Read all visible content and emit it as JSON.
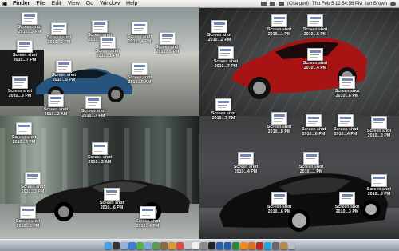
{
  "menubar": {
    "apple": "",
    "app_name": "Finder",
    "menus": [
      "File",
      "Edit",
      "View",
      "Go",
      "Window",
      "Help"
    ],
    "status": {
      "battery": "(Charged)",
      "datetime": "Thu Feb 5  12:54:56 PM",
      "user": "Ian Brown"
    }
  },
  "desktop": {
    "icons": [
      {
        "label": "Screen shot\n2010...3 PM"
      },
      {
        "label": "Screen shot\n2010...2 PM"
      },
      {
        "label": "Screen shot\n2010...9 PM"
      },
      {
        "label": "Screen shot\n2010...4 PM"
      },
      {
        "label": "Screen shot\n2010...6 PM"
      },
      {
        "label": "Screen shot\n2010...7 PM"
      },
      {
        "label": "Screen shot\n2010...1 PM"
      },
      {
        "label": "Screen shot\n2010...5 PM"
      },
      {
        "label": "Screen shot\n2010...9 AM"
      },
      {
        "label": "Screen shot\n2010...3 PM"
      },
      {
        "label": "Screen shot\n2010...2 AM"
      },
      {
        "label": "Screen shot\n2010...7 PM"
      },
      {
        "label": "Screen shot\n2010...6 PM"
      },
      {
        "label": "Screen shot\n2010...3 AM"
      },
      {
        "label": "Screen shot\n2010...3 PM"
      },
      {
        "label": "Screen shot\n2010...6 PM"
      },
      {
        "label": "Screen shot\n2010...5 PM"
      },
      {
        "label": "Screen shot\n2010...4 PM"
      },
      {
        "label": "Screen shot\n2010...2 PM"
      },
      {
        "label": "Screen shot\n2010...1 PM"
      },
      {
        "label": "Screen shot\n2010...6 PM"
      },
      {
        "label": "Screen shot\n2010...7 PM"
      },
      {
        "label": "Screen shot\n2010...4 PM"
      },
      {
        "label": "Screen shot\n2010...6 PM"
      },
      {
        "label": "Screen shot\n2010...7 PM"
      },
      {
        "label": "Screen shot\n2010...8 PM"
      },
      {
        "label": "Screen shot\n2010...6 PM"
      },
      {
        "label": "Screen shot\n2010...4 PM"
      },
      {
        "label": "Screen shot\n2010...3 PM"
      },
      {
        "label": "Screen shot\n2010...4 PM"
      },
      {
        "label": "Screen shot\n2010...1 PM"
      },
      {
        "label": "Screen shot\n2010...9 PM"
      },
      {
        "label": "Screen shot\n2010...6 PM"
      },
      {
        "label": "Screen shot\n2010...3 PM"
      }
    ]
  },
  "dock": {
    "apps": [
      "finder",
      "dashboard",
      "mail",
      "safari",
      "ichat",
      "itunes",
      "iphoto",
      "imovie",
      "garageband",
      "ical",
      "preview",
      "textedit",
      "system-preferences",
      "terminal",
      "photoshop",
      "word",
      "excel",
      "vlc",
      "firefox",
      "acrobat",
      "skype",
      "calculator",
      "address-book",
      "trash"
    ]
  }
}
